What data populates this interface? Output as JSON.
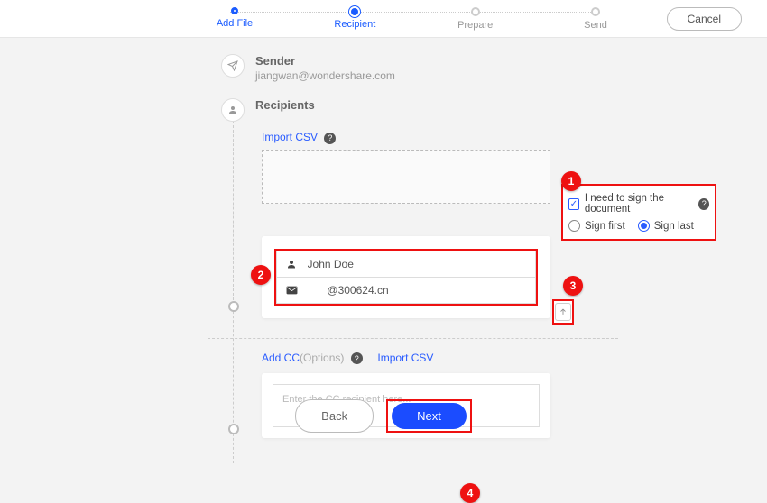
{
  "topbar": {
    "cancel": "Cancel",
    "steps": [
      {
        "label": "Add File",
        "state": "done"
      },
      {
        "label": "Recipient",
        "state": "current"
      },
      {
        "label": "Prepare",
        "state": "todo"
      },
      {
        "label": "Send",
        "state": "todo"
      }
    ]
  },
  "sender": {
    "title": "Sender",
    "email": "jiangwan@wondershare.com"
  },
  "recipients": {
    "title": "Recipients",
    "import_csv": "Import CSV",
    "sign": {
      "need_label": "I need to sign the document",
      "need_checked": true,
      "options": {
        "first": "Sign first",
        "last": "Sign last",
        "selected": "last"
      }
    },
    "entry": {
      "name": "John Doe",
      "email": "@300624.cn"
    }
  },
  "cc": {
    "add_cc": "Add CC",
    "options_suffix": "(Options)",
    "import_csv": "Import CSV",
    "placeholder": "Enter the CC recipient here..."
  },
  "footer": {
    "back": "Back",
    "next": "Next"
  },
  "annotations": {
    "a1": "1",
    "a2": "2",
    "a3": "3",
    "a4": "4"
  }
}
